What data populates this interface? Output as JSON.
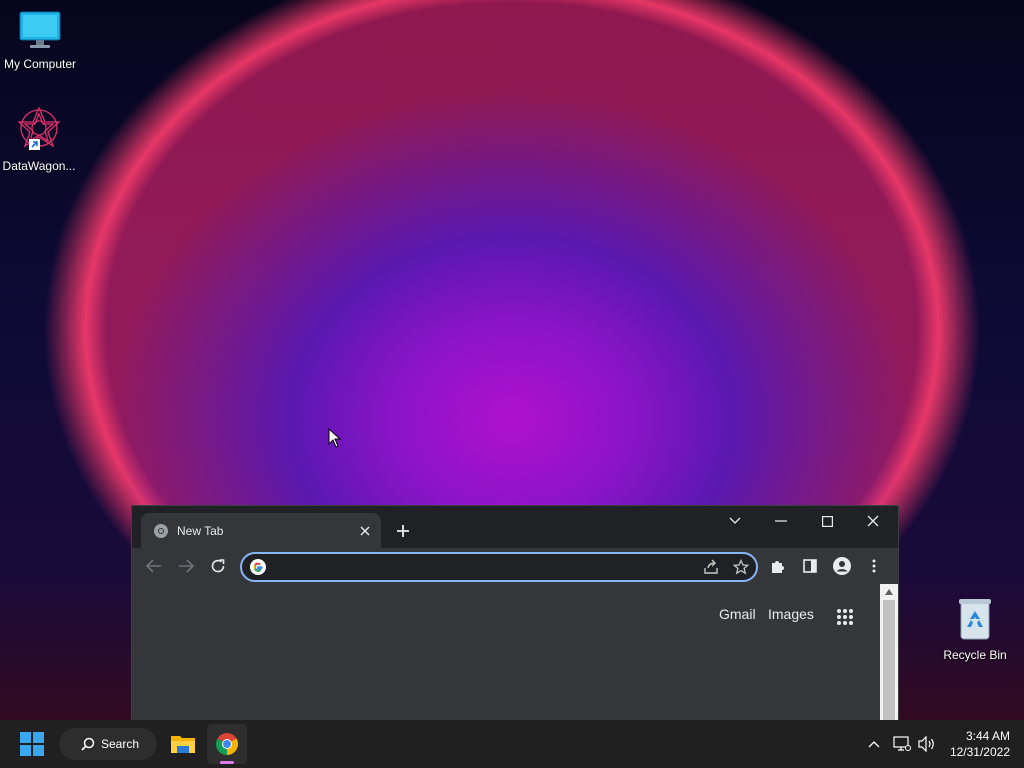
{
  "desktop": {
    "icons": [
      {
        "label": "My Computer"
      },
      {
        "label": "DataWagon..."
      },
      {
        "label": "Recycle Bin"
      }
    ]
  },
  "browser": {
    "tab_title": "New Tab",
    "address_value": "",
    "links": {
      "gmail": "Gmail",
      "images": "Images"
    },
    "accent": "#8ab4f8"
  },
  "taskbar": {
    "search_label": "Search",
    "time": "3:44 AM",
    "date": "12/31/2022"
  }
}
